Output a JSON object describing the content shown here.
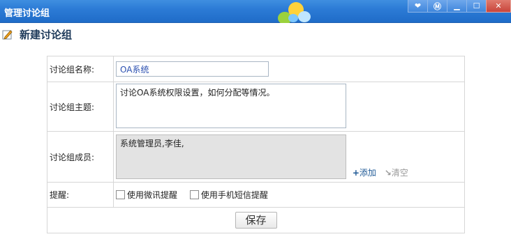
{
  "window": {
    "title": "管理讨论组",
    "buttons": [
      "favorite-icon",
      "manual-icon",
      "minimize-icon",
      "maximize-icon",
      "close-icon"
    ]
  },
  "heading": {
    "title": "新建讨论组"
  },
  "form": {
    "name": {
      "label": "讨论组名称:",
      "value": "OA系统"
    },
    "topic": {
      "label": "讨论组主题:",
      "value": "讨论OA系统权限设置，如何分配等情况。"
    },
    "members": {
      "label": "讨论组成员:",
      "value": "系统管理员,李佳,",
      "add_label": "添加",
      "clear_label": "清空"
    },
    "reminder": {
      "label": "提醒:",
      "option1": "使用微讯提醒",
      "option2": "使用手机短信提醒"
    },
    "save_label": "保存"
  },
  "colors": {
    "titlebar": "#2c7bd6",
    "link": "#1f5a96",
    "heading": "#1e3a5a"
  }
}
